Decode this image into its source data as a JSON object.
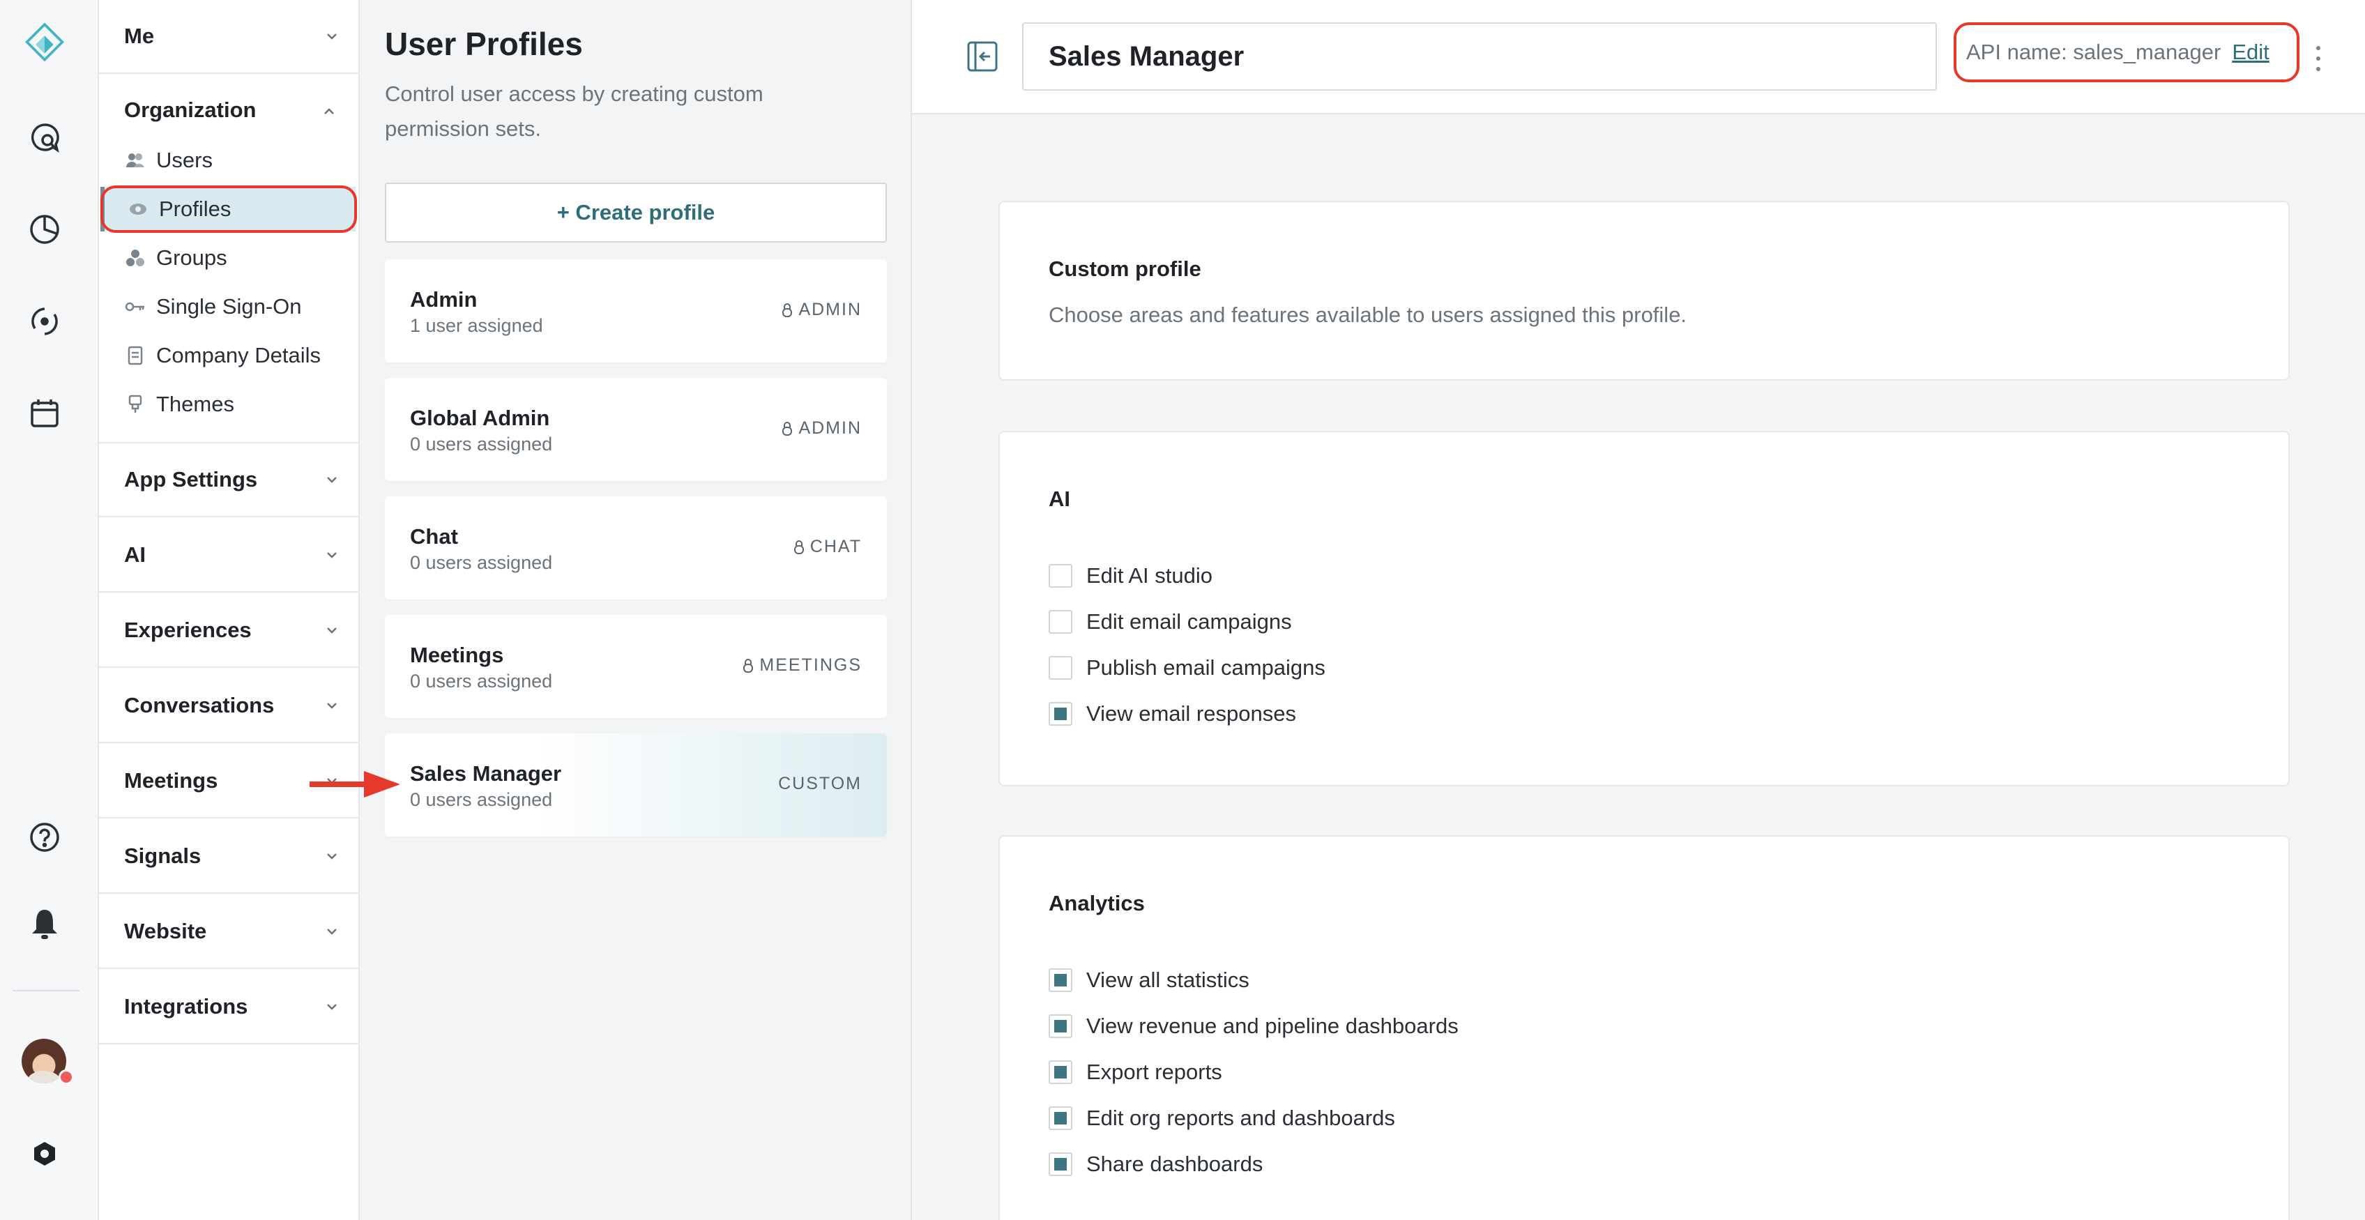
{
  "rail": {
    "icons": [
      "logo-icon",
      "chat-search-icon",
      "pie-chart-icon",
      "signals-icon",
      "calendar-icon",
      "help-icon",
      "bell-icon",
      "settings-icon"
    ],
    "accent": "#3fb6c6"
  },
  "nav": {
    "me": "Me",
    "organization": "Organization",
    "org_items": [
      {
        "label": "Users",
        "icon": "users-icon"
      },
      {
        "label": "Profiles",
        "icon": "eye-icon"
      },
      {
        "label": "Groups",
        "icon": "groups-icon"
      },
      {
        "label": "Single Sign-On",
        "icon": "key-icon"
      },
      {
        "label": "Company Details",
        "icon": "document-icon"
      },
      {
        "label": "Themes",
        "icon": "brush-icon"
      }
    ],
    "sections": [
      "App Settings",
      "AI",
      "Experiences",
      "Conversations",
      "Meetings",
      "Signals",
      "Website",
      "Integrations"
    ]
  },
  "profiles": {
    "title": "User Profiles",
    "description": "Control user access by creating custom permission sets.",
    "create_label": "+ Create profile",
    "items": [
      {
        "name": "Admin",
        "sub": "1 user assigned",
        "tag": "ADMIN"
      },
      {
        "name": "Global Admin",
        "sub": "0 users assigned",
        "tag": "ADMIN"
      },
      {
        "name": "Chat",
        "sub": "0 users assigned",
        "tag": "CHAT"
      },
      {
        "name": "Meetings",
        "sub": "0 users assigned",
        "tag": "MEETINGS"
      },
      {
        "name": "Sales Manager",
        "sub": "0 users assigned",
        "tag": "CUSTOM"
      }
    ]
  },
  "main": {
    "profile_name": "Sales Manager",
    "api_label": "API name: sales_manager",
    "edit_label": "Edit",
    "custom": {
      "title": "Custom profile",
      "desc": "Choose areas and features available to users assigned this profile."
    },
    "ai": {
      "title": "AI",
      "options": [
        {
          "label": "Edit AI studio",
          "checked": false
        },
        {
          "label": "Edit email campaigns",
          "checked": false
        },
        {
          "label": "Publish email campaigns",
          "checked": false
        },
        {
          "label": "View email responses",
          "checked": true
        }
      ]
    },
    "analytics": {
      "title": "Analytics",
      "options": [
        {
          "label": "View all statistics",
          "checked": true
        },
        {
          "label": "View revenue and pipeline dashboards",
          "checked": true
        },
        {
          "label": "Export reports",
          "checked": true
        },
        {
          "label": "Edit org reports and dashboards",
          "checked": true
        },
        {
          "label": "Share dashboards",
          "checked": true
        }
      ]
    }
  },
  "colors": {
    "annotation_red": "#e4392b",
    "brand_teal": "#2f6e79",
    "checkbox_fill": "#3d7582",
    "active_nav": "#d9ebf0"
  }
}
